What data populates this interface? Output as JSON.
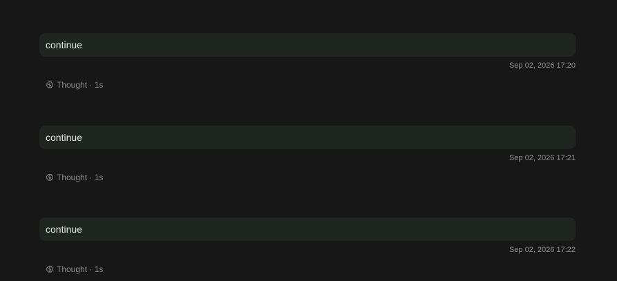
{
  "conversation": {
    "turns": [
      {
        "user_message": "continue",
        "timestamp": "Sep 02, 2026 17:20",
        "thought_label": "Thought · 1s",
        "thought_icon": "brain-icon"
      },
      {
        "user_message": "continue",
        "timestamp": "Sep 02, 2026 17:21",
        "thought_label": "Thought · 1s",
        "thought_icon": "brain-icon"
      },
      {
        "user_message": "continue",
        "timestamp": "Sep 02, 2026 17:22",
        "thought_label": "Thought · 1s",
        "thought_icon": "brain-icon"
      }
    ]
  },
  "colors": {
    "background": "#171717",
    "bubble": "#1f2520",
    "text": "#e6e6e6",
    "muted": "#8a8a8a"
  }
}
